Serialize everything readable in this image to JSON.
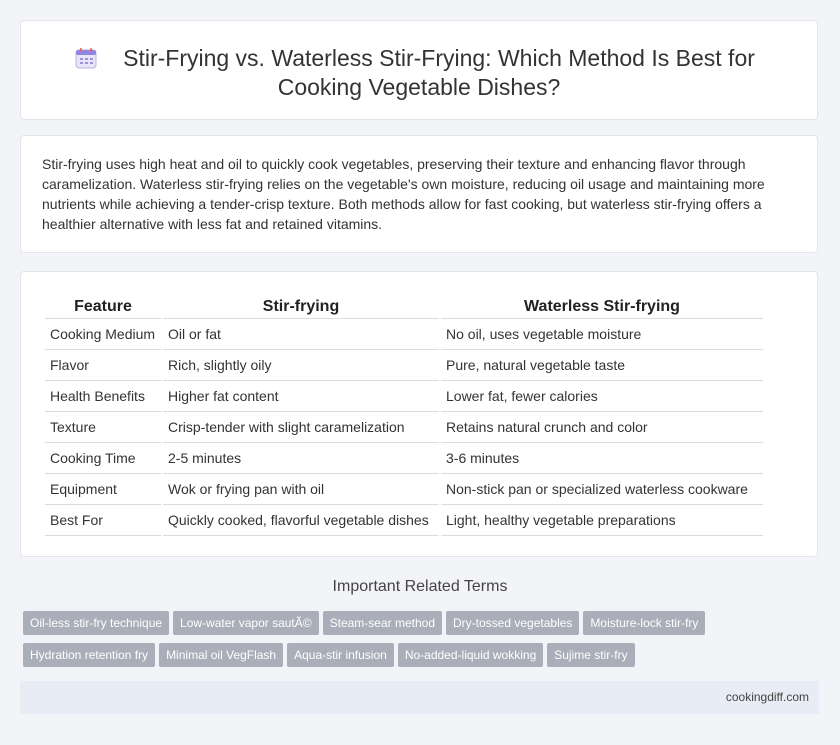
{
  "header": {
    "icon": "calendar-icon",
    "title_line1": "Stir-Frying vs. Waterless Stir-Frying: Which Method Is Best for",
    "title_line2": "Cooking Vegetable Dishes?"
  },
  "intro": {
    "text": "Stir-frying uses high heat and oil to quickly cook vegetables, preserving their texture and enhancing flavor through caramelization. Waterless stir-frying relies on the vegetable's own moisture, reducing oil usage and maintaining more nutrients while achieving a tender-crisp texture. Both methods allow for fast cooking, but waterless stir-frying offers a healthier alternative with less fat and retained vitamins."
  },
  "table": {
    "headers": [
      "Feature",
      "Stir-frying",
      "Waterless Stir-frying"
    ],
    "rows": [
      [
        "Cooking Medium",
        "Oil or fat",
        "No oil, uses vegetable moisture"
      ],
      [
        "Flavor",
        "Rich, slightly oily",
        "Pure, natural vegetable taste"
      ],
      [
        "Health Benefits",
        "Higher fat content",
        "Lower fat, fewer calories"
      ],
      [
        "Texture",
        "Crisp-tender with slight caramelization",
        "Retains natural crunch and color"
      ],
      [
        "Cooking Time",
        "2-5 minutes",
        "3-6 minutes"
      ],
      [
        "Equipment",
        "Wok or frying pan with oil",
        "Non-stick pan or specialized waterless cookware"
      ],
      [
        "Best For",
        "Quickly cooked, flavorful vegetable dishes",
        "Light, healthy vegetable preparations"
      ]
    ]
  },
  "related": {
    "title": "Important Related Terms",
    "tags": [
      "Oil-less stir-fry technique",
      "Low-water vapor sautÃ©",
      "Steam-sear method",
      "Dry-tossed vegetables",
      "Moisture-lock stir-fry",
      "Hydration retention fry",
      "Minimal oil VegFlash",
      "Aqua-stir infusion",
      "No-added-liquid wokking",
      "Sujime stir-fry"
    ]
  },
  "footer": {
    "site": "cookingdiff.com"
  },
  "colors": {
    "background": "#f3f4f8",
    "tag_bg": "#a9aeb8",
    "footer_bg": "#e8ecf4"
  }
}
